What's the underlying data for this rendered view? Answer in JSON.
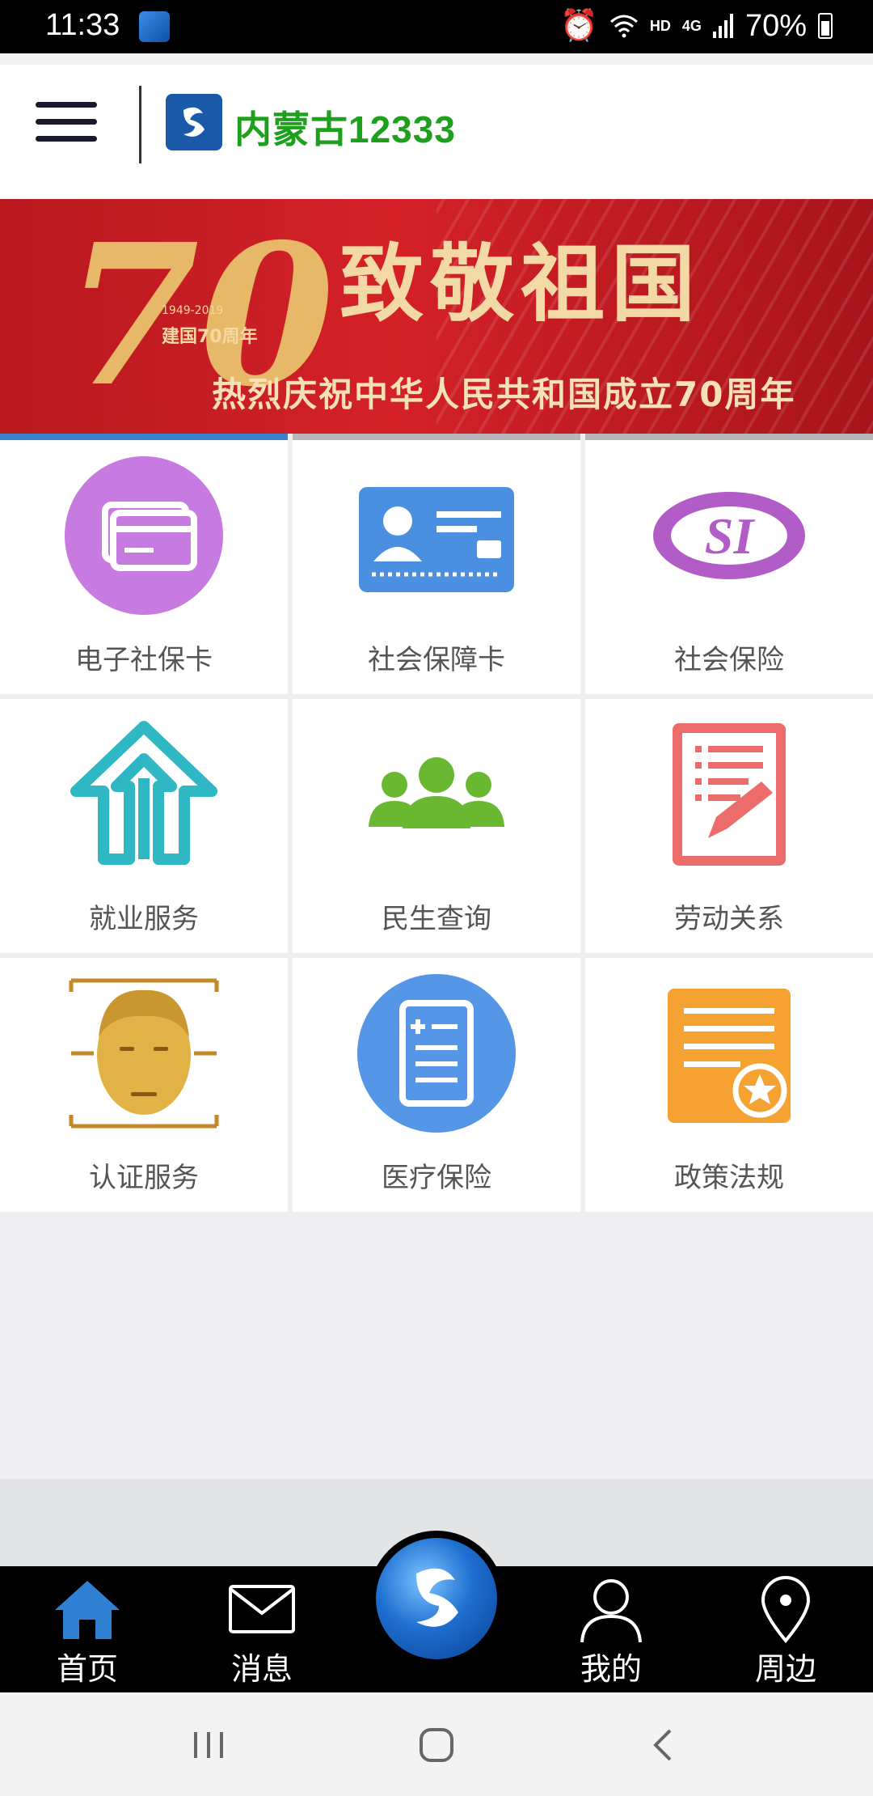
{
  "status_bar": {
    "time": "11:33",
    "network_label": "HD",
    "signal_label": "4G",
    "battery": "70%"
  },
  "header": {
    "logo_text": "内蒙古12333"
  },
  "banner": {
    "headline": "致敬祖国",
    "subline": "热烈庆祝中华人民共和国成立70周年",
    "seventy": "70",
    "years": "1949-2019",
    "caption": "建国70周年"
  },
  "services": [
    {
      "label": "电子社保卡",
      "icon": "e-card-icon",
      "color": "#c77be0"
    },
    {
      "label": "社会保障卡",
      "icon": "id-card-icon",
      "color": "#4a8fe0"
    },
    {
      "label": "社会保险",
      "icon": "si-logo-icon",
      "color": "#b15cc7"
    },
    {
      "label": "就业服务",
      "icon": "upload-house-icon",
      "color": "#2fb8c4"
    },
    {
      "label": "民生查询",
      "icon": "people-group-icon",
      "color": "#6ab832"
    },
    {
      "label": "劳动关系",
      "icon": "document-edit-icon",
      "color": "#ec6b6b"
    },
    {
      "label": "认证服务",
      "icon": "face-recognition-icon",
      "color": "#e2b246"
    },
    {
      "label": "医疗保险",
      "icon": "medical-record-icon",
      "color": "#5596e6"
    },
    {
      "label": "政策法规",
      "icon": "policy-certificate-icon",
      "color": "#f5a232"
    }
  ],
  "tabbar": {
    "home": "首页",
    "messages": "消息",
    "mine": "我的",
    "nearby": "周边",
    "active_color": "#2f7fd3"
  }
}
